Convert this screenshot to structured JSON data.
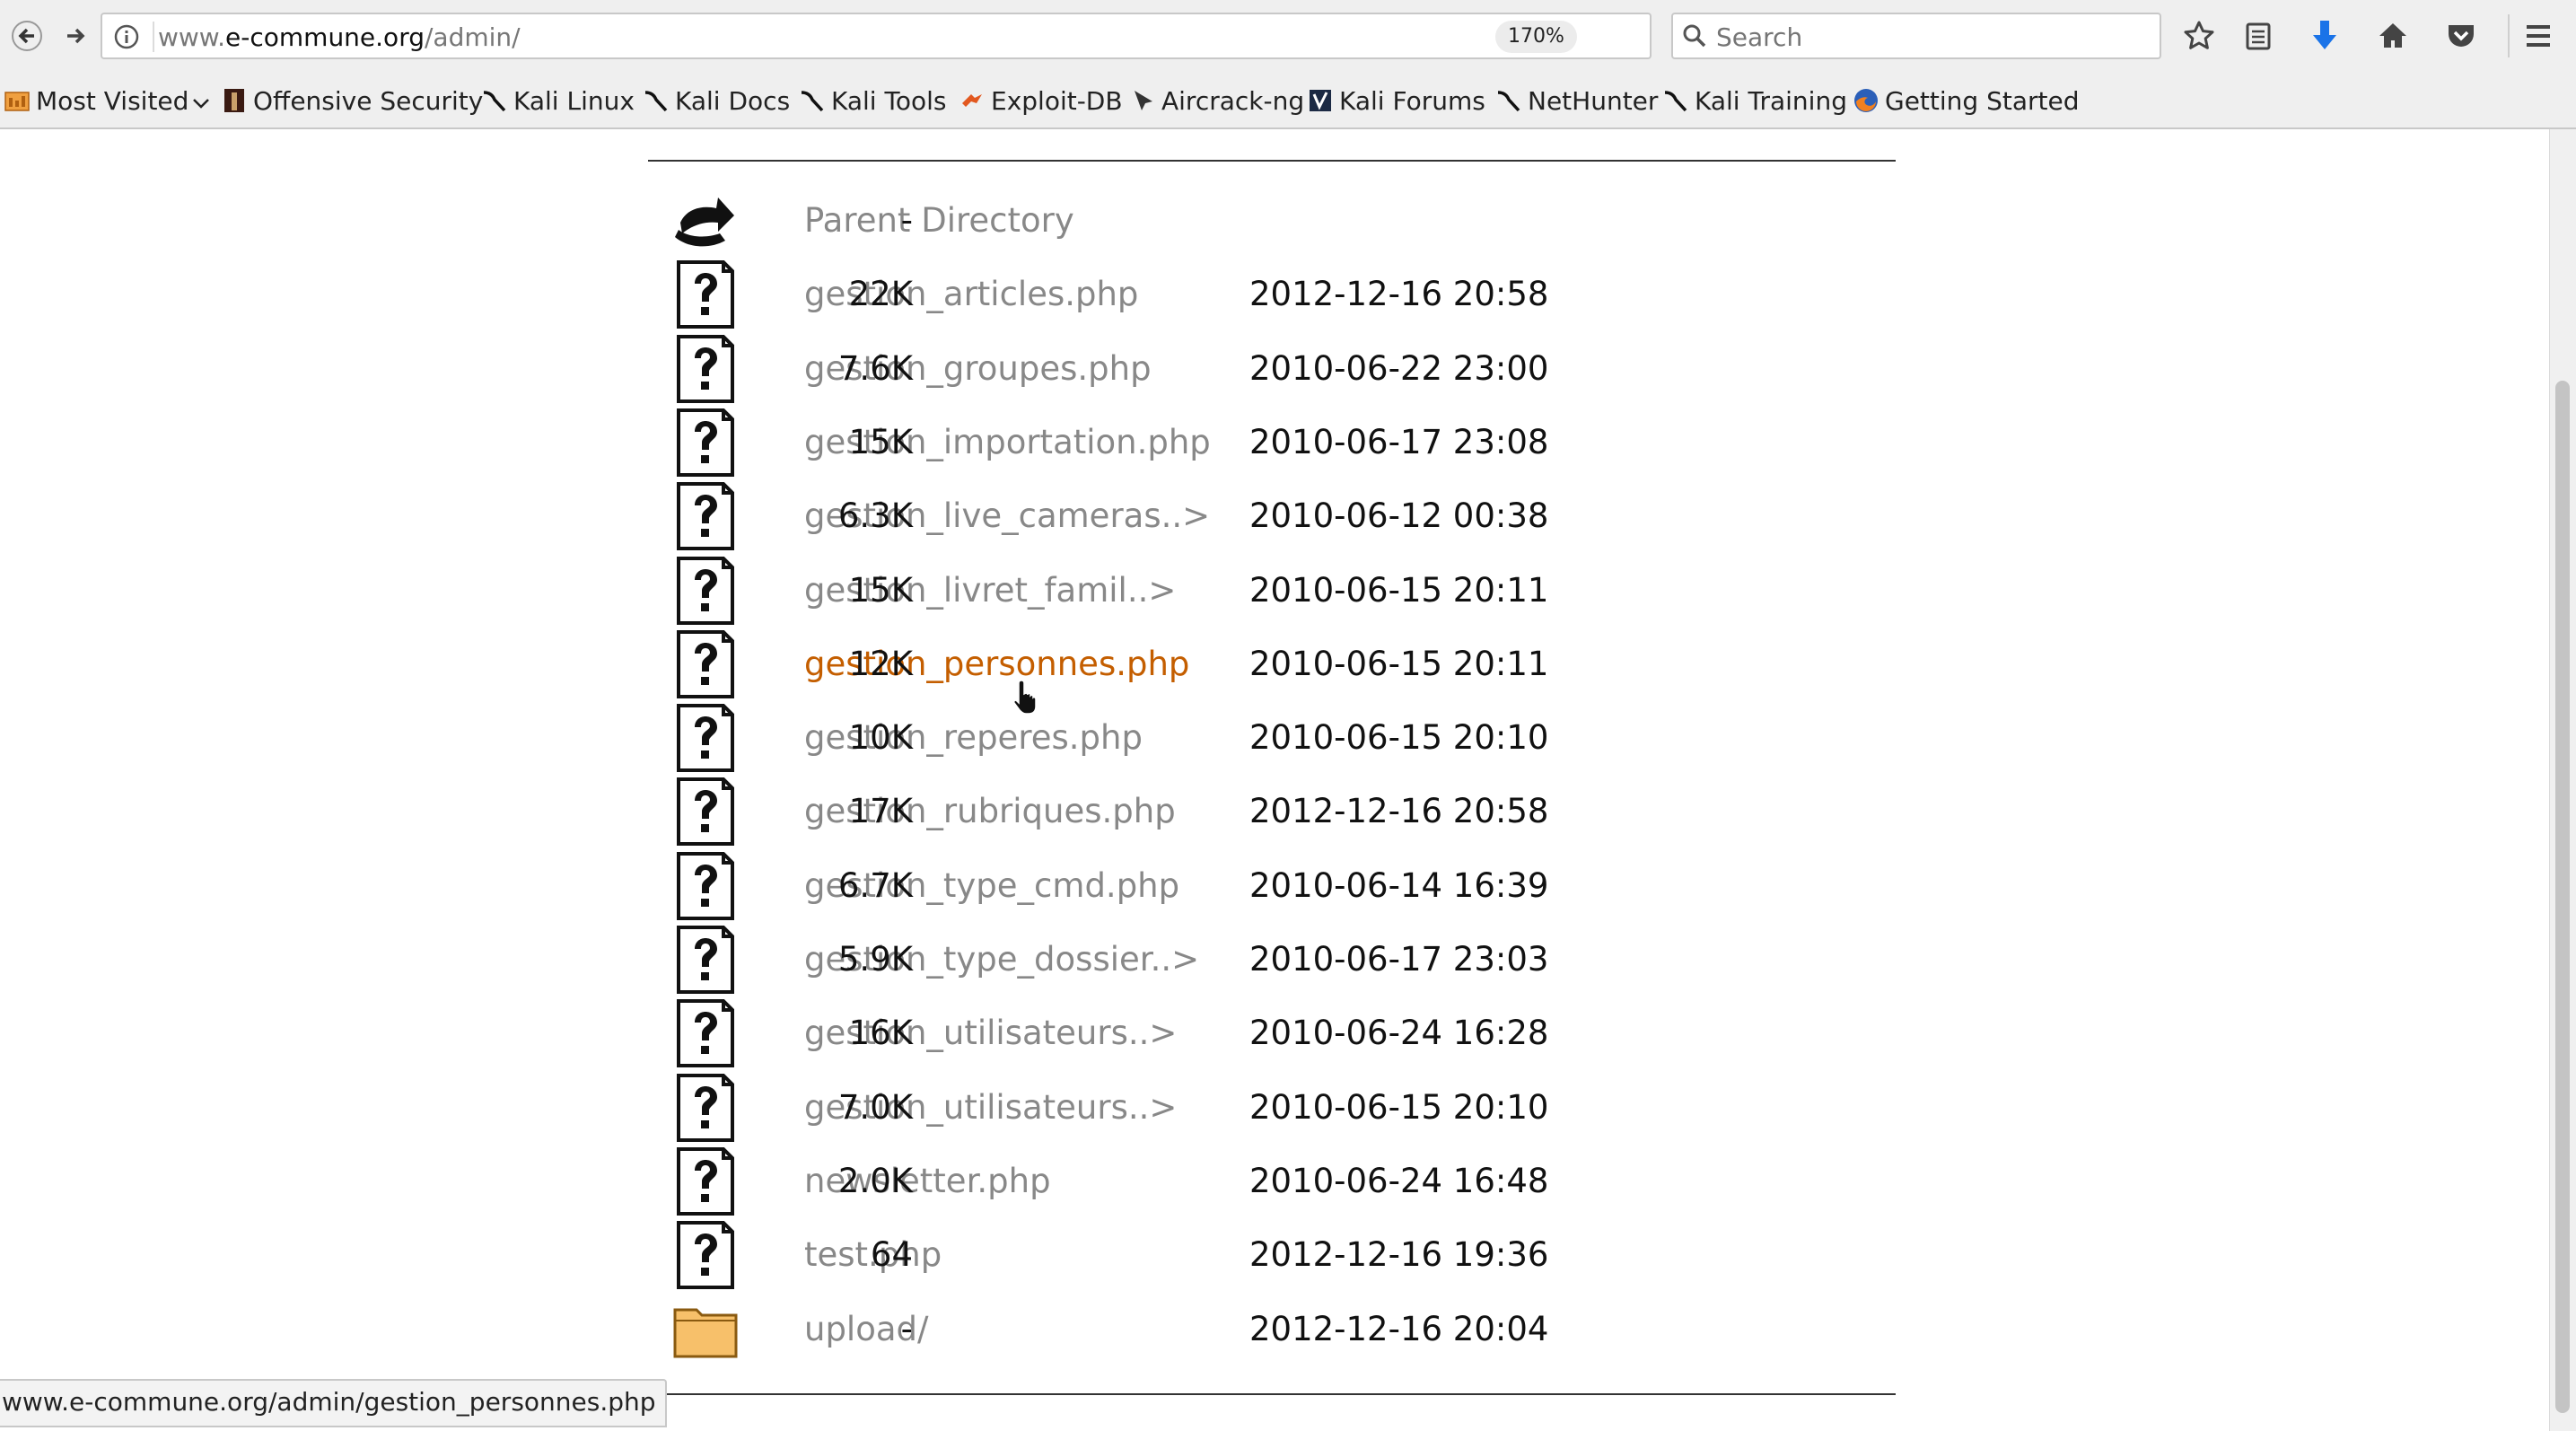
{
  "browser": {
    "url_prefix": "www.",
    "url_host": "e-commune.org",
    "url_path": "/admin/",
    "zoom": "170%",
    "search_placeholder": "Search"
  },
  "bookmarks": [
    {
      "label": "Most Visited",
      "icon": "folder-icon"
    },
    {
      "label": "Offensive Security",
      "icon": "offsec-icon"
    },
    {
      "label": "Kali Linux",
      "icon": "kali-icon"
    },
    {
      "label": "Kali Docs",
      "icon": "kali-icon"
    },
    {
      "label": "Kali Tools",
      "icon": "kali-icon"
    },
    {
      "label": "Exploit-DB",
      "icon": "exploitdb-icon"
    },
    {
      "label": "Aircrack-ng",
      "icon": "aircrack-icon"
    },
    {
      "label": "Kali Forums",
      "icon": "forums-icon"
    },
    {
      "label": "NetHunter",
      "icon": "kali-icon"
    },
    {
      "label": "Kali Training",
      "icon": "kali-icon"
    },
    {
      "label": "Getting Started",
      "icon": "firefox-icon"
    }
  ],
  "listing": {
    "rows": [
      {
        "name": "Parent Directory",
        "date": "",
        "size": "-",
        "icon": "back-icon"
      },
      {
        "name": "gestion_articles.php",
        "date": "2012-12-16 20:58",
        "size": "22K",
        "icon": "unknown-file-icon"
      },
      {
        "name": "gestion_groupes.php",
        "date": "2010-06-22 23:00",
        "size": "7.6K",
        "icon": "unknown-file-icon"
      },
      {
        "name": "gestion_importation.php",
        "date": "2010-06-17 23:08",
        "size": "15K",
        "icon": "unknown-file-icon"
      },
      {
        "name": "gestion_live_cameras..>",
        "date": "2010-06-12 00:38",
        "size": "6.3K",
        "icon": "unknown-file-icon"
      },
      {
        "name": "gestion_livret_famil..>",
        "date": "2010-06-15 20:11",
        "size": "15K",
        "icon": "unknown-file-icon"
      },
      {
        "name": "gestion_personnes.php",
        "date": "2010-06-15 20:11",
        "size": "12K",
        "icon": "unknown-file-icon",
        "hovered": true
      },
      {
        "name": "gestion_reperes.php",
        "date": "2010-06-15 20:10",
        "size": "10K",
        "icon": "unknown-file-icon"
      },
      {
        "name": "gestion_rubriques.php",
        "date": "2012-12-16 20:58",
        "size": "17K",
        "icon": "unknown-file-icon"
      },
      {
        "name": "gestion_type_cmd.php",
        "date": "2010-06-14 16:39",
        "size": "6.7K",
        "icon": "unknown-file-icon"
      },
      {
        "name": "gestion_type_dossier..>",
        "date": "2010-06-17 23:03",
        "size": "5.9K",
        "icon": "unknown-file-icon"
      },
      {
        "name": "gestion_utilisateurs..>",
        "date": "2010-06-24 16:28",
        "size": "16K",
        "icon": "unknown-file-icon"
      },
      {
        "name": "gestion_utilisateurs..>",
        "date": "2010-06-15 20:10",
        "size": "7.0K",
        "icon": "unknown-file-icon"
      },
      {
        "name": "newsletter.php",
        "date": "2010-06-24 16:48",
        "size": "2.0K",
        "icon": "unknown-file-icon"
      },
      {
        "name": "test.php",
        "date": "2012-12-16 19:36",
        "size": "64",
        "icon": "unknown-file-icon"
      },
      {
        "name": "upload/",
        "date": "2012-12-16 20:04",
        "size": "-",
        "icon": "folder-icon"
      }
    ]
  },
  "status": {
    "link_url": "www.e-commune.org/admin/gestion_personnes.php"
  },
  "colors": {
    "link": "#888888",
    "link_hover": "#c45e00",
    "toolbar_bg": "#efefef",
    "download_arrow": "#1a73e8"
  }
}
